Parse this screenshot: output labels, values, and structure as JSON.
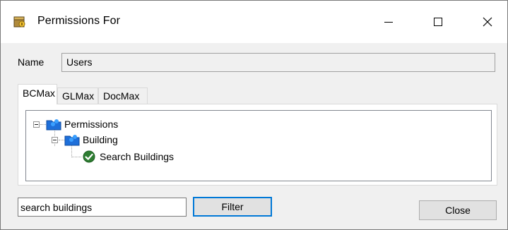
{
  "window": {
    "title": "Permissions For",
    "icon": "app-icon",
    "controls": {
      "minimize": "minimize-icon",
      "maximize": "maximize-icon",
      "close": "close-icon"
    }
  },
  "name": {
    "label": "Name",
    "value": "Users"
  },
  "tabs": [
    {
      "label": "BCMax",
      "active": true
    },
    {
      "label": "GLMax",
      "active": false
    },
    {
      "label": "DocMax",
      "active": false
    }
  ],
  "tree": {
    "nodes": [
      {
        "label": "Permissions",
        "icon": "folder-users-icon",
        "expanded": true
      },
      {
        "label": "Building",
        "icon": "folder-users-icon",
        "expanded": true
      },
      {
        "label": "Search Buildings",
        "icon": "check-circle-icon",
        "checked": true
      }
    ]
  },
  "filter": {
    "value": "search buildings",
    "button_label": "Filter"
  },
  "footer": {
    "close_label": "Close"
  },
  "colors": {
    "accent": "#0078d7",
    "check_green": "#2e7d32",
    "folder_blue": "#1e6fd9"
  }
}
